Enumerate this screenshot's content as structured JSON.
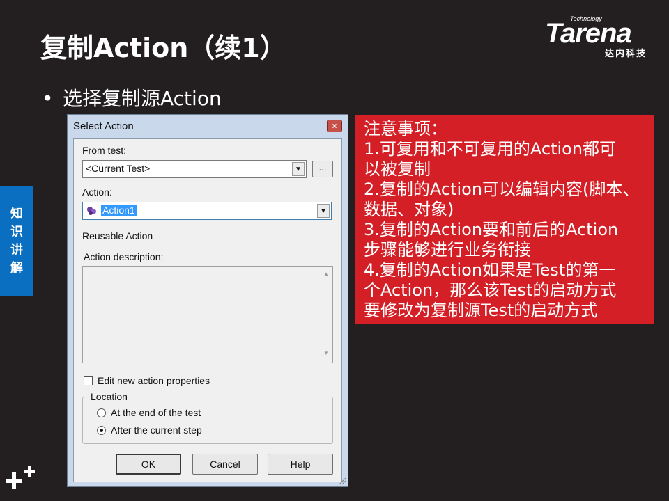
{
  "slide": {
    "title": "复制Action（续1）",
    "bullet": "选择复制源Action",
    "side_tab": [
      "知",
      "识",
      "讲",
      "解"
    ]
  },
  "logo": {
    "tagline": "Technology",
    "name": "Tarena",
    "chinese": "达内科技"
  },
  "dialog": {
    "title": "Select Action",
    "close_label": "×",
    "from_test_label": "From test:",
    "from_test_value": "<Current Test>",
    "browse_label": "...",
    "action_label": "Action:",
    "action_value": "Action1",
    "reusable_label": "Reusable Action",
    "description_label": "Action description:",
    "description_value": "",
    "edit_props_label": "Edit new action properties",
    "edit_props_checked": false,
    "location_legend": "Location",
    "location_options": [
      {
        "label": "At the end of the test",
        "selected": false
      },
      {
        "label": "After the current step",
        "selected": true
      }
    ],
    "ok_label": "OK",
    "cancel_label": "Cancel",
    "help_label": "Help"
  },
  "note": {
    "lines": [
      "注意事项：",
      "1.可复用和不可复用的Action都可",
      "以被复制",
      "2.复制的Action可以编辑内容(脚本、",
      "数据、对象)",
      "3.复制的Action要和前后的Action",
      "步骤能够进行业务衔接",
      "4.复制的Action如果是Test的第一",
      "个Action，那么该Test的启动方式",
      "要修改为复制源Test的启动方式"
    ],
    "background": "#d41f26"
  },
  "colors": {
    "slide_bg": "#231f20",
    "side_tab": "#0a6fc0",
    "dialog_frame": "#c9d8ea",
    "selection": "#3399ff"
  }
}
